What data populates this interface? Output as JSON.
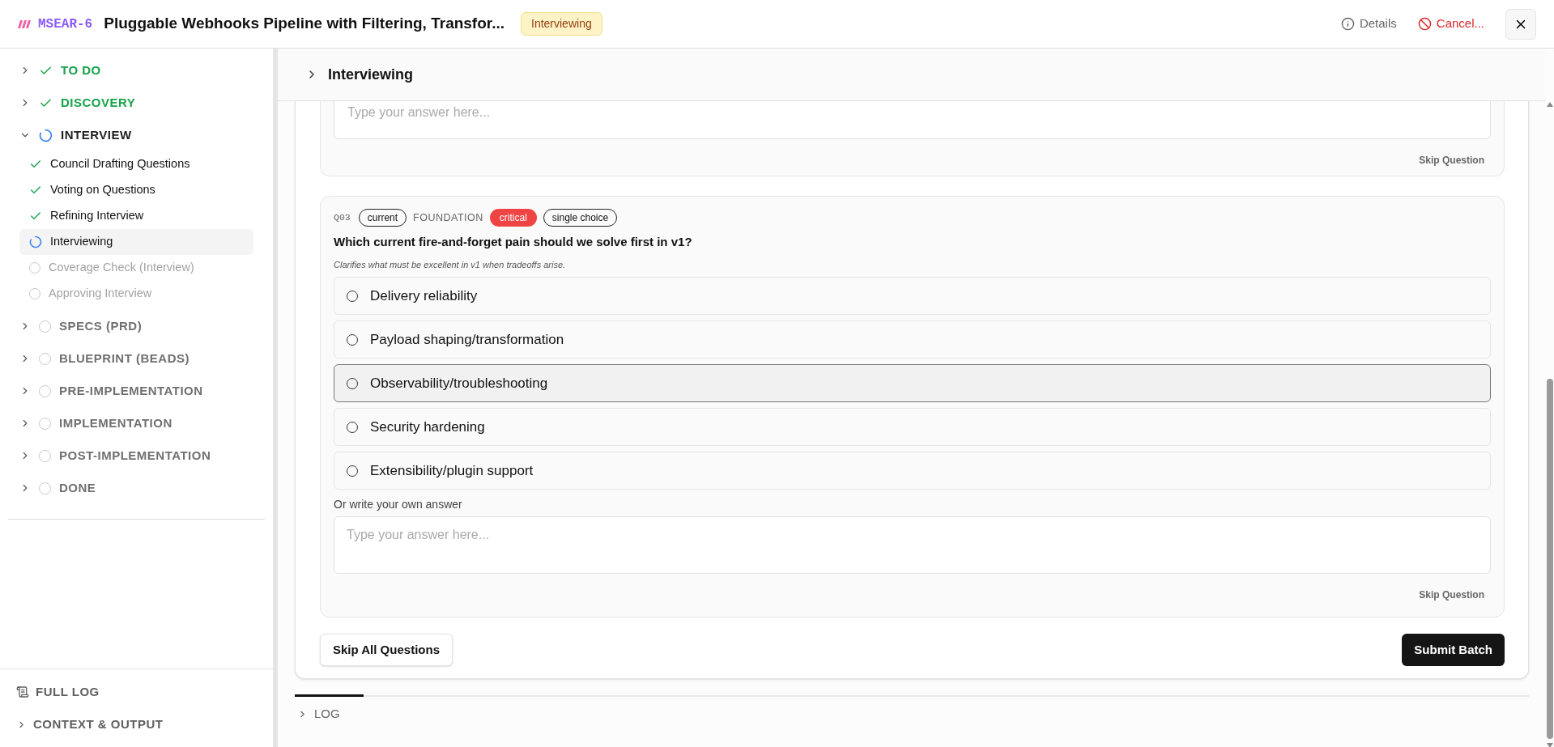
{
  "header": {
    "key": "MSEAR-6",
    "title": "Pluggable Webhooks Pipeline with Filtering, Transfor...",
    "status_badge": "Interviewing",
    "actions": [
      {
        "label": "Details",
        "kind": "info"
      },
      {
        "label": "Cancel...",
        "kind": "cancel"
      }
    ]
  },
  "sidebar": {
    "phases": [
      {
        "label": "TO DO",
        "kind": "done",
        "expanded": false
      },
      {
        "label": "DISCOVERY",
        "kind": "done",
        "expanded": false
      },
      {
        "label": "INTERVIEW",
        "kind": "active",
        "expanded": true,
        "children": [
          {
            "label": "Council Drafting Questions",
            "kind": "done",
            "selected": false
          },
          {
            "label": "Voting on Questions",
            "kind": "done",
            "selected": false
          },
          {
            "label": "Refining Interview",
            "kind": "done",
            "selected": false
          },
          {
            "label": "Interviewing",
            "kind": "active",
            "selected": true
          },
          {
            "label": "Coverage Check (Interview)",
            "kind": "pending",
            "selected": false
          },
          {
            "label": "Approving Interview",
            "kind": "pending",
            "selected": false
          }
        ]
      },
      {
        "label": "SPECS (PRD)",
        "kind": "pending",
        "expanded": false
      },
      {
        "label": "BLUEPRINT (BEADS)",
        "kind": "pending",
        "expanded": false
      },
      {
        "label": "PRE-IMPLEMENTATION",
        "kind": "pending",
        "expanded": false
      },
      {
        "label": "IMPLEMENTATION",
        "kind": "pending",
        "expanded": false
      },
      {
        "label": "POST-IMPLEMENTATION",
        "kind": "pending",
        "expanded": false
      },
      {
        "label": "DONE",
        "kind": "pending",
        "expanded": false
      }
    ],
    "footer": [
      {
        "label": "FULL LOG",
        "kind": "log"
      },
      {
        "label": "CONTEXT & OUTPUT",
        "kind": "expander"
      }
    ]
  },
  "stage": {
    "title": "Interviewing",
    "expanded": false
  },
  "previous_question": {
    "answer_placeholder": "Type your answer here...",
    "skip_label": "Skip Question"
  },
  "question": {
    "number": "Q03",
    "tags": [
      {
        "label": "current",
        "kind": "outline"
      },
      {
        "label": "FOUNDATION",
        "kind": "plain"
      },
      {
        "label": "critical",
        "kind": "danger"
      },
      {
        "label": "single choice",
        "kind": "outline"
      }
    ],
    "text": "Which current fire-and-forget pain should we solve first in v1?",
    "hint": "Clarifies what must be excellent in v1 when tradeoffs arise.",
    "options": [
      {
        "label": "Delivery reliability",
        "selected": false,
        "highlighted": false
      },
      {
        "label": "Payload shaping/transformation",
        "selected": false,
        "highlighted": false
      },
      {
        "label": "Observability/troubleshooting",
        "selected": false,
        "highlighted": true
      },
      {
        "label": "Security hardening",
        "selected": false,
        "highlighted": false
      },
      {
        "label": "Extensibility/plugin support",
        "selected": false,
        "highlighted": false
      }
    ],
    "custom_label": "Or write your own answer",
    "answer_placeholder": "Type your answer here...",
    "skip_label": "Skip Question"
  },
  "batch_actions": {
    "skip_all": "Skip All Questions",
    "submit": "Submit Batch"
  },
  "log_panel": {
    "title": "LOG",
    "expanded": false
  }
}
